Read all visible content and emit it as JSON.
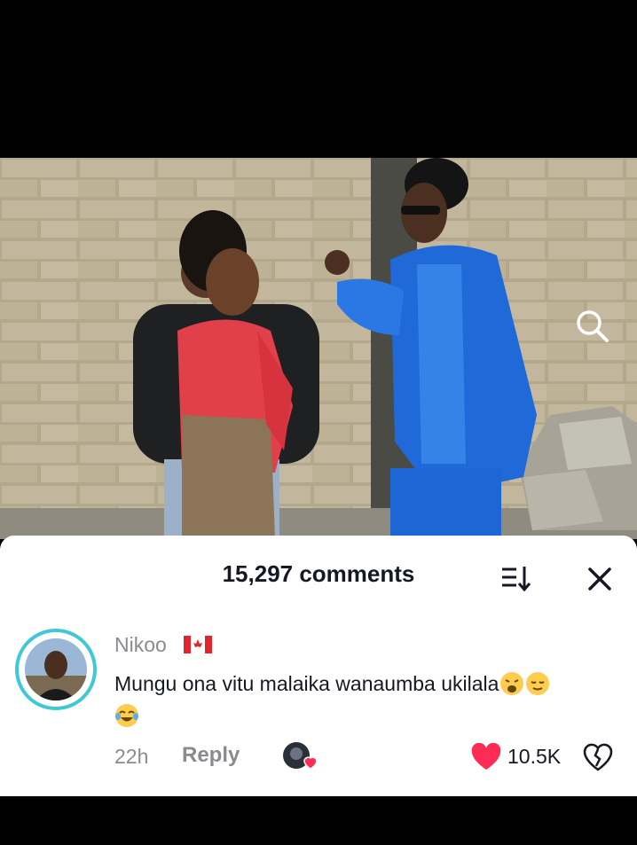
{
  "sheet": {
    "title": "15,297 comments"
  },
  "comment": {
    "username": "Nikoo",
    "flag": "canada-flag",
    "text": "Mungu ona vitu malaika wanaumba ukilala",
    "emojis": [
      "weary-face-emoji",
      "relieved-face-emoji",
      "tears-of-joy-emoji"
    ],
    "time": "22h",
    "reply_label": "Reply",
    "like_count": "10.5K",
    "liked": true
  },
  "colors": {
    "like": "#fe2c55",
    "avatar_ring": "#3fc8d6",
    "muted_text": "#8a8b91"
  }
}
